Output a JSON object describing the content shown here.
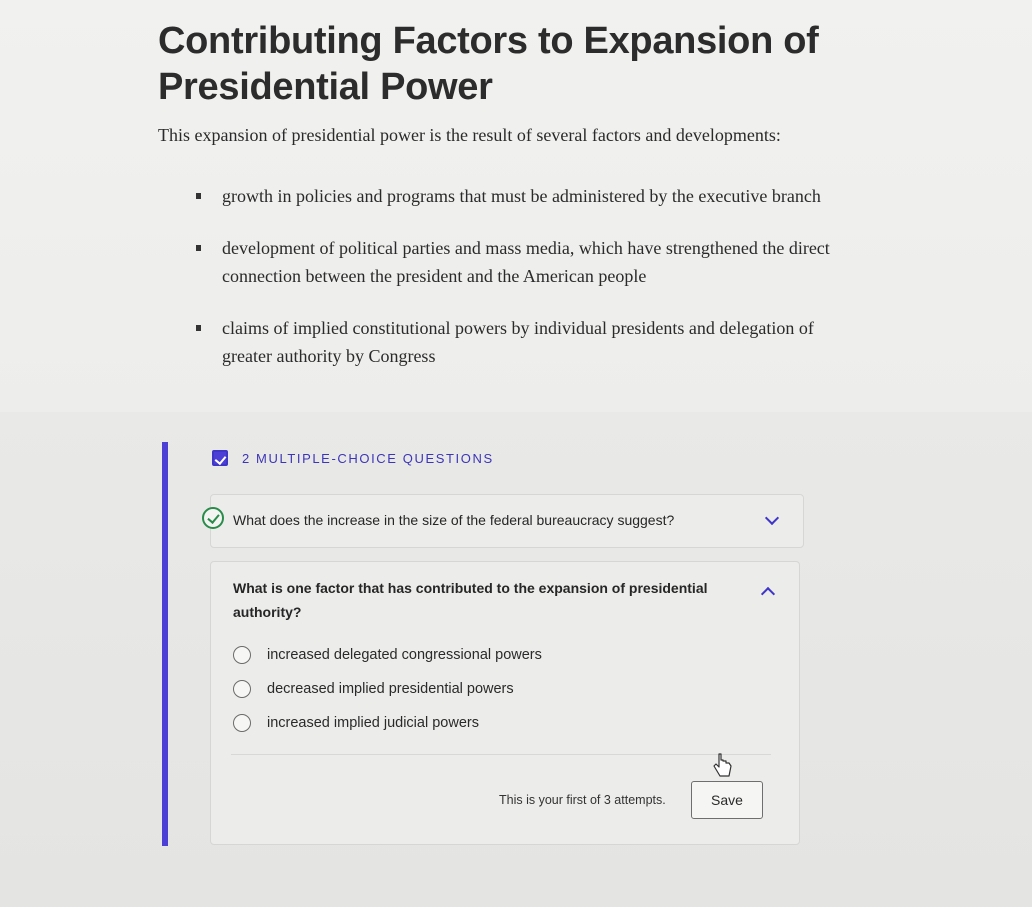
{
  "reading": {
    "title": "Contributing Factors to Expansion of Presidential Power",
    "intro": "This expansion of presidential power is the result of several factors and developments:",
    "bullets": [
      "growth in policies and programs that must be administered by the executive branch",
      "development of political parties and mass media, which have strengthened the direct connection between the president and the American people",
      "claims of implied constitutional powers by individual presidents and delegation of greater authority by Congress"
    ]
  },
  "quiz": {
    "section_label": "2 MULTIPLE-CHOICE QUESTIONS",
    "accent_color": "#4b3fd6",
    "questions": [
      {
        "text": "What does the increase in the size of the federal bureaucracy suggest?",
        "status": "answered-correct",
        "expanded": false
      },
      {
        "text": "What is one factor that has contributed to the expansion of presidential authority?",
        "status": "unanswered",
        "expanded": true,
        "options": [
          "increased delegated congressional powers",
          "decreased implied presidential powers",
          "increased implied judicial powers"
        ],
        "attempts_text": "This is your first of 3 attempts.",
        "save_label": "Save"
      }
    ]
  },
  "icons": {
    "section": "checklist-icon",
    "answered": "check-circle-icon",
    "collapse": "chevron-down-icon",
    "expand": "chevron-up-icon",
    "cursor": "pointer-hand-icon"
  }
}
